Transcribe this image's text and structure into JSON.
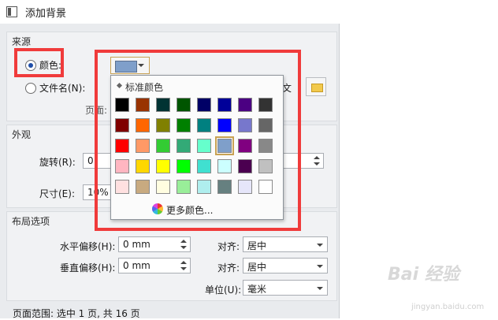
{
  "window": {
    "title": "添加背景"
  },
  "source": {
    "group_title": "来源",
    "color_label": "颜色:",
    "file_label": "文件名(N):",
    "file_btn_text": "文",
    "page_label": "页面:"
  },
  "color_popup": {
    "title": "标准颜色",
    "more_label": "更多颜色...",
    "selected_color": "#7f9fca",
    "swatches": [
      [
        "#000000",
        "#993300",
        "#003333",
        "#005500",
        "#000066",
        "#000099",
        "#4b0082",
        "#333333"
      ],
      [
        "#800000",
        "#ff6600",
        "#808000",
        "#008000",
        "#008080",
        "#0000ff",
        "#7777cc",
        "#666666"
      ],
      [
        "#ff0000",
        "#ff9966",
        "#33cc33",
        "#33aa77",
        "#66ffcc",
        "#7f9fca",
        "#800080",
        "#888888"
      ],
      [
        "#ffb6c1",
        "#ffd700",
        "#ffff00",
        "#00ff00",
        "#40e0d0",
        "#ccffff",
        "#4b0050",
        "#c0c0c0"
      ],
      [
        "#ffe0e0",
        "#c8aa80",
        "#fffde0",
        "#99ee99",
        "#afeeee",
        "#668080",
        "#e6e6fa",
        "#ffffff"
      ]
    ]
  },
  "appearance": {
    "group_title": "外观",
    "rotate_label": "旋转(R):",
    "rotate_value": "0",
    "size_label": "尺寸(E):",
    "size_value": "10%"
  },
  "layout": {
    "group_title": "布局选项",
    "hoffset_label": "水平偏移(H):",
    "hoffset_value": "0 mm",
    "voffset_label": "垂直偏移(H):",
    "voffset_value": "0 mm",
    "align1_label": "对齐:",
    "align1_value": "居中",
    "align2_label": "对齐:",
    "align2_value": "居中",
    "unit_label": "单位(U):",
    "unit_value": "毫米"
  },
  "footer": {
    "text": "页面范围: 选中 1 页, 共 16 页"
  },
  "watermark": {
    "text": "Bai 经验",
    "sub": "jingyan.baidu.com"
  }
}
